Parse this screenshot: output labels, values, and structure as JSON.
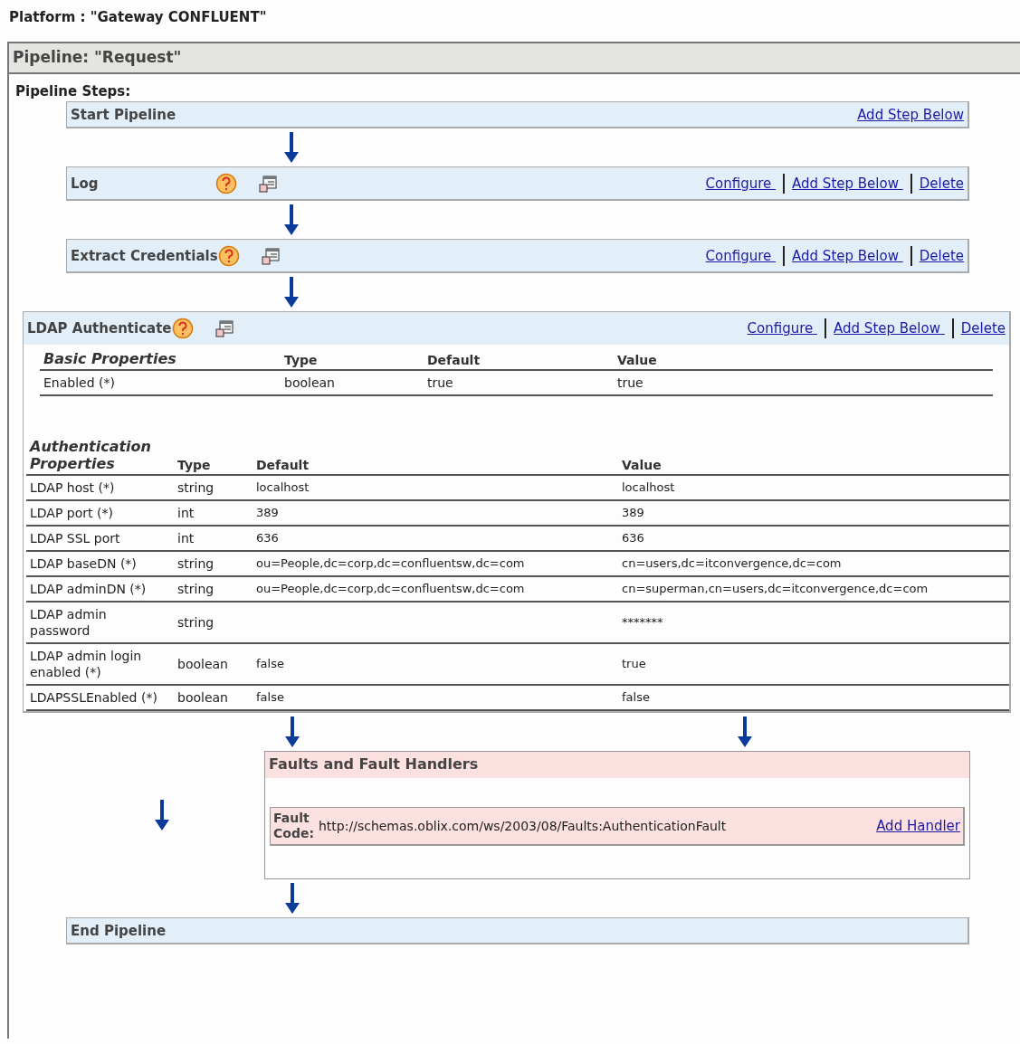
{
  "platform_title": "Platform : \"Gateway CONFLUENT\"",
  "pipeline": {
    "title": "Pipeline: \"Request\"",
    "steps_label": "Pipeline Steps:",
    "steps": [
      {
        "kind": "start",
        "name": "Start Pipeline",
        "links": [
          "Add Step Below"
        ]
      },
      {
        "kind": "step",
        "name": "Log",
        "links": [
          "Configure ",
          "Add Step Below ",
          "Delete"
        ]
      },
      {
        "kind": "step",
        "name": "Extract Credentials",
        "links": [
          "Configure ",
          "Add Step Below ",
          "Delete"
        ]
      },
      {
        "kind": "detail",
        "name": "LDAP Authenticate",
        "links": [
          "Configure ",
          "Add Step Below ",
          "Delete"
        ],
        "basic": {
          "columns": [
            "Basic Properties",
            "Type",
            "Default",
            "Value"
          ],
          "rows": [
            [
              "Enabled (*)",
              "boolean",
              "true",
              "true"
            ]
          ]
        },
        "auth": {
          "columns": [
            "Authentication Properties",
            "Type",
            "Default",
            "Value"
          ],
          "rows": [
            [
              "LDAP host (*)",
              "string",
              "localhost",
              "localhost"
            ],
            [
              "LDAP port (*)",
              "int",
              "389",
              "389"
            ],
            [
              "LDAP SSL port",
              "int",
              "636",
              "636"
            ],
            [
              "LDAP baseDN (*)",
              "string",
              "ou=People,dc=corp,dc=confluentsw,dc=com",
              "cn=users,dc=itconvergence,dc=com"
            ],
            [
              "LDAP adminDN (*)",
              "string",
              "ou=People,dc=corp,dc=confluentsw,dc=com",
              "cn=superman,cn=users,dc=itconvergence,dc=com"
            ],
            [
              "LDAP admin password",
              "string",
              "",
              "*******"
            ],
            [
              "LDAP admin login enabled (*)",
              "boolean",
              "false",
              "true"
            ],
            [
              "LDAPSSLEnabled (*)",
              "boolean",
              "false",
              "false"
            ]
          ]
        }
      },
      {
        "kind": "faults",
        "title": "Faults and Fault Handlers",
        "faults": [
          {
            "label": "Fault Code:",
            "code": "http://schemas.oblix.com/ws/2003/08/Faults:AuthenticationFault",
            "link": "Add Handler"
          }
        ]
      },
      {
        "kind": "end",
        "name": "End Pipeline"
      }
    ]
  }
}
